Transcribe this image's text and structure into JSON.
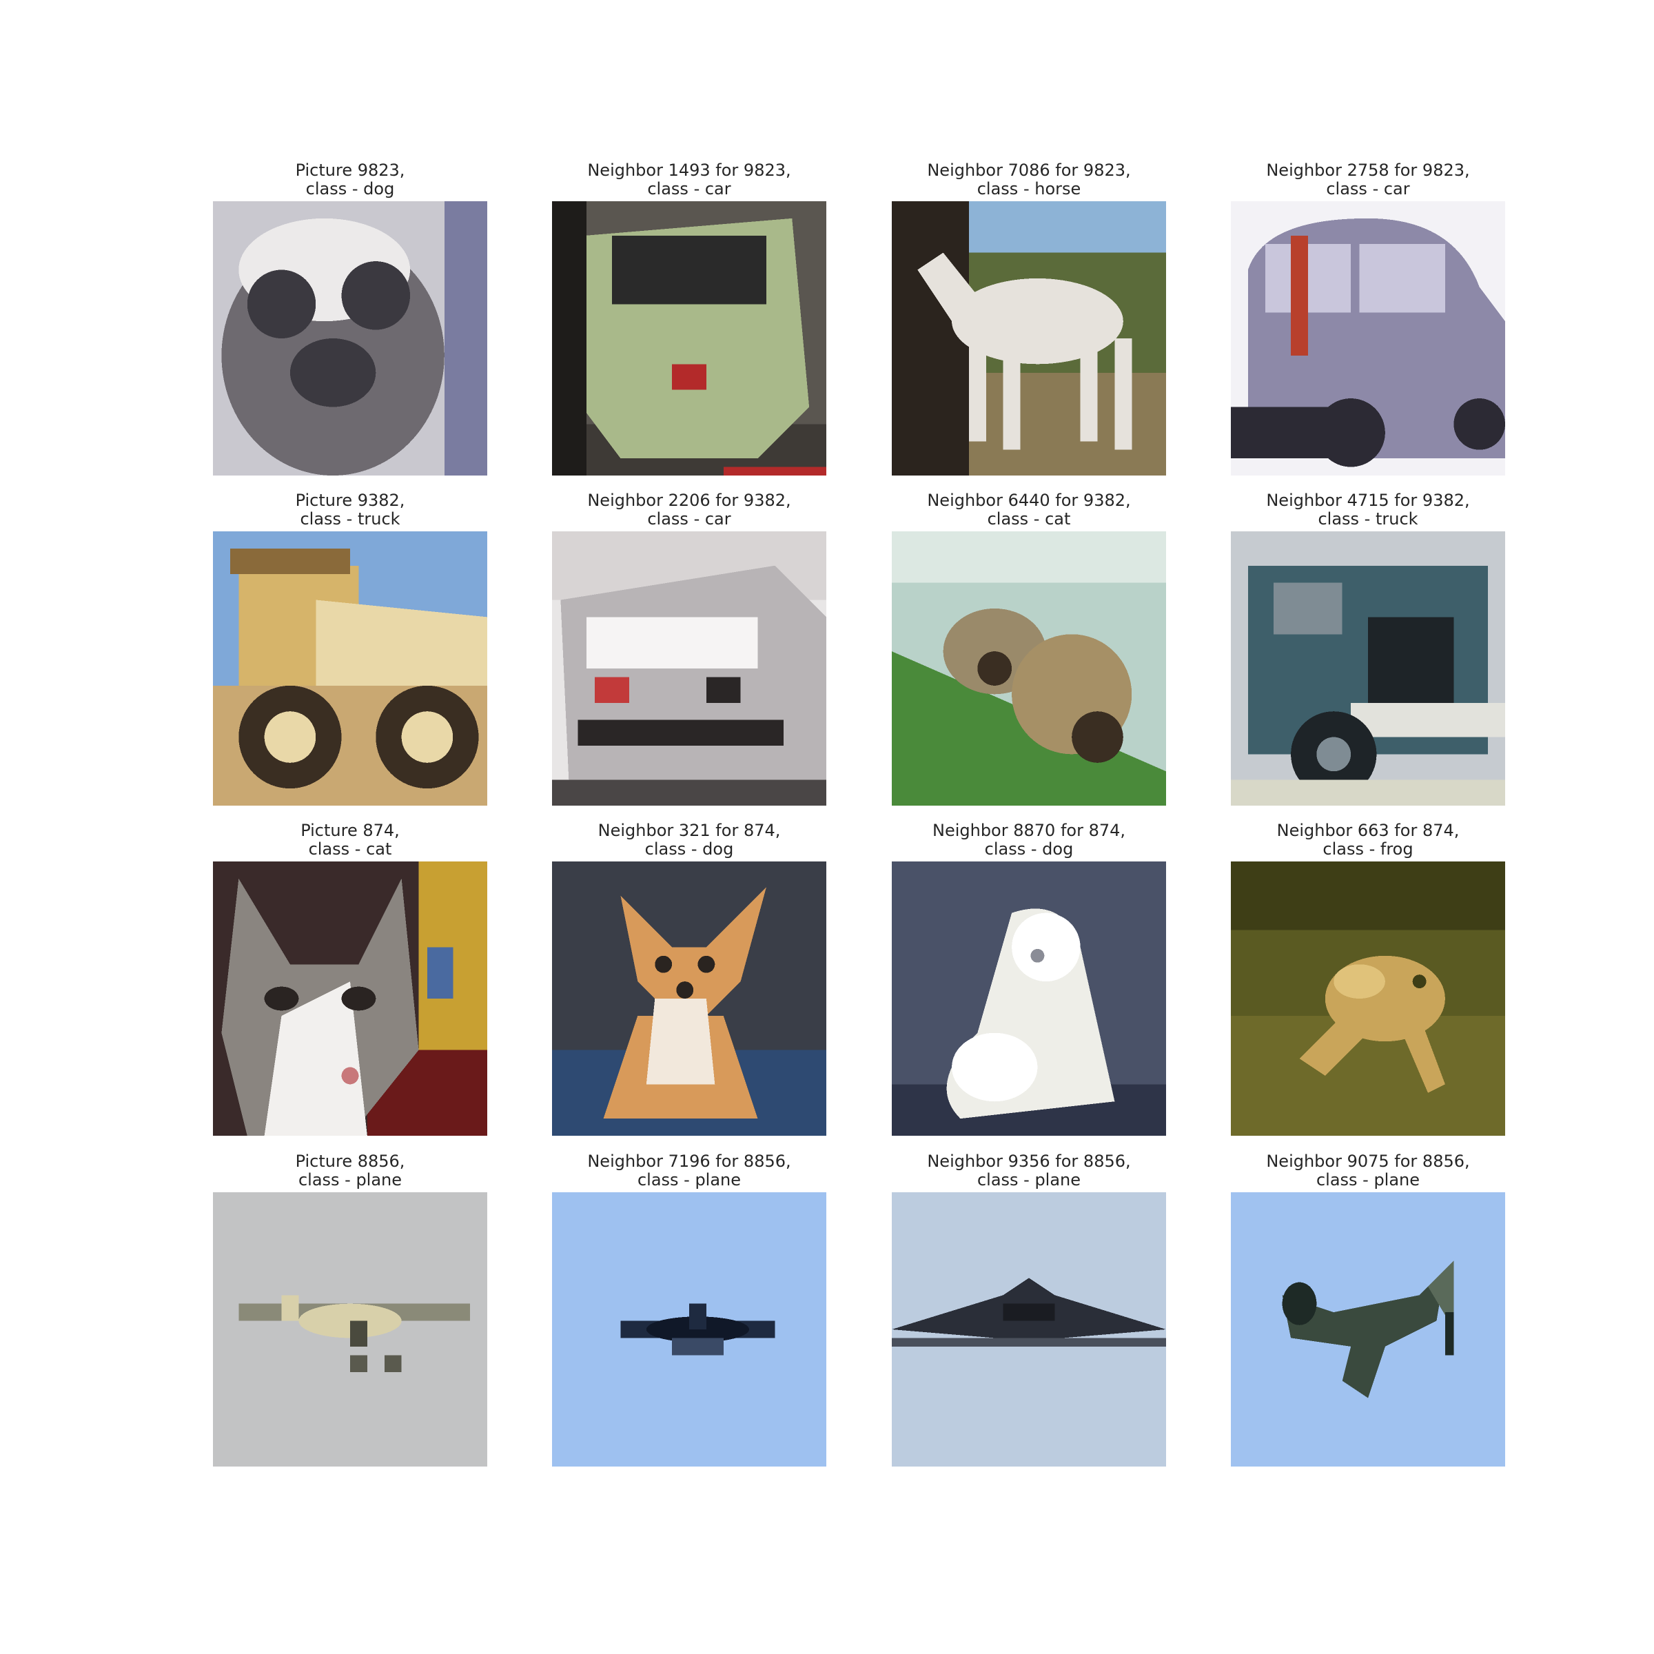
{
  "rows": [
    {
      "cells": [
        {
          "line1": "Picture 9823,",
          "line2": "class - dog",
          "scene": "dog-face",
          "colors": {
            "bg": "#c9c8cf",
            "main": "#6e6a70",
            "accent": "#3b3940",
            "light": "#eceaea"
          }
        },
        {
          "line1": "Neighbor 1493 for 9823,",
          "line2": "class - car",
          "scene": "car-rear",
          "colors": {
            "bg": "#5a5650",
            "main": "#a9b98a",
            "accent": "#2a2a2a",
            "light": "#d9d9cf",
            "detail": "#b32a2a"
          }
        },
        {
          "line1": "Neighbor 7086 for 9823,",
          "line2": "class - horse",
          "scene": "horse",
          "colors": {
            "bg": "#8db3d6",
            "main": "#e6e2dc",
            "accent": "#5b6b3a",
            "light": "#8a7a55",
            "detail": "#2b241e"
          }
        },
        {
          "line1": "Neighbor 2758 for 9823,",
          "line2": "class - car",
          "scene": "car-side",
          "colors": {
            "bg": "#f3f2f6",
            "main": "#8d89a8",
            "accent": "#2c2a34",
            "light": "#c9c6dc",
            "detail": "#b8402c"
          }
        }
      ]
    },
    {
      "cells": [
        {
          "line1": "Picture 9382,",
          "line2": "class - truck",
          "scene": "dump-truck",
          "colors": {
            "bg": "#7fa8d8",
            "main": "#d6b46a",
            "accent": "#3a2e22",
            "light": "#e9d8a8",
            "detail": "#8a6a3a"
          }
        },
        {
          "line1": "Neighbor 2206 for 9382,",
          "line2": "class - car",
          "scene": "car-front",
          "colors": {
            "bg": "#e8e6e6",
            "main": "#b8b4b6",
            "accent": "#2a2626",
            "light": "#f6f4f4",
            "detail": "#c23a3a"
          }
        },
        {
          "line1": "Neighbor 6440 for 9382,",
          "line2": "class - cat",
          "scene": "cats-grass",
          "colors": {
            "bg": "#b9d2c9",
            "main": "#9a8a6a",
            "accent": "#4a8a3a",
            "light": "#dce8e2",
            "detail": "#3a2e22"
          }
        },
        {
          "line1": "Neighbor 4715 for 9382,",
          "line2": "class - truck",
          "scene": "old-truck",
          "colors": {
            "bg": "#c6cbd0",
            "main": "#3e5f6a",
            "accent": "#1e2428",
            "light": "#e2e2dc",
            "detail": "#7f8c94"
          }
        }
      ]
    },
    {
      "cells": [
        {
          "line1": "Picture 874,",
          "line2": "class - cat",
          "scene": "cat-face",
          "colors": {
            "bg": "#3a2a2a",
            "main": "#8a8580",
            "accent": "#2a2422",
            "light": "#f2f0ee",
            "detail": "#6a1a1a"
          }
        },
        {
          "line1": "Neighbor 321 for 874,",
          "line2": "class - dog",
          "scene": "chihuahua",
          "colors": {
            "bg": "#3a3e48",
            "main": "#d89a5a",
            "accent": "#2e4a72",
            "light": "#f2e8dc",
            "detail": "#2a2420"
          }
        },
        {
          "line1": "Neighbor 8870 for 874,",
          "line2": "class - dog",
          "scene": "white-dog",
          "colors": {
            "bg": "#4a5268",
            "main": "#eeeee8",
            "accent": "#2e3448",
            "light": "#ffffff",
            "detail": "#8a8c96"
          }
        },
        {
          "line1": "Neighbor 663 for 874,",
          "line2": "class - frog",
          "scene": "frog",
          "colors": {
            "bg": "#5a5a22",
            "main": "#c9a55a",
            "accent": "#3e3e16",
            "light": "#e0c27a",
            "detail": "#6e6a2a"
          }
        }
      ]
    },
    {
      "cells": [
        {
          "line1": "Picture 8856,",
          "line2": "class - plane",
          "scene": "plane-small",
          "colors": {
            "bg": "#c2c3c4",
            "main": "#8a8a78",
            "accent": "#4a4a3e",
            "light": "#d8d0aa",
            "detail": "#5a5a4e"
          }
        },
        {
          "line1": "Neighbor 7196 for 8856,",
          "line2": "class - plane",
          "scene": "plane-dark",
          "colors": {
            "bg": "#9ec1f0",
            "main": "#1e2a40",
            "accent": "#101828",
            "light": "#b4d0f4",
            "detail": "#3a4a66"
          }
        },
        {
          "line1": "Neighbor 9356 for 8856,",
          "line2": "class - plane",
          "scene": "plane-wing",
          "colors": {
            "bg": "#bcccdf",
            "main": "#2a2e38",
            "accent": "#1a1c22",
            "light": "#cfdae8",
            "detail": "#4a505c"
          }
        },
        {
          "line1": "Neighbor 9075 for 8856,",
          "line2": "class - plane",
          "scene": "plane-fighter",
          "colors": {
            "bg": "#a0c2f0",
            "main": "#3a4a3e",
            "accent": "#1e2a26",
            "light": "#b6d0f4",
            "detail": "#5a6a5a"
          }
        }
      ]
    }
  ]
}
